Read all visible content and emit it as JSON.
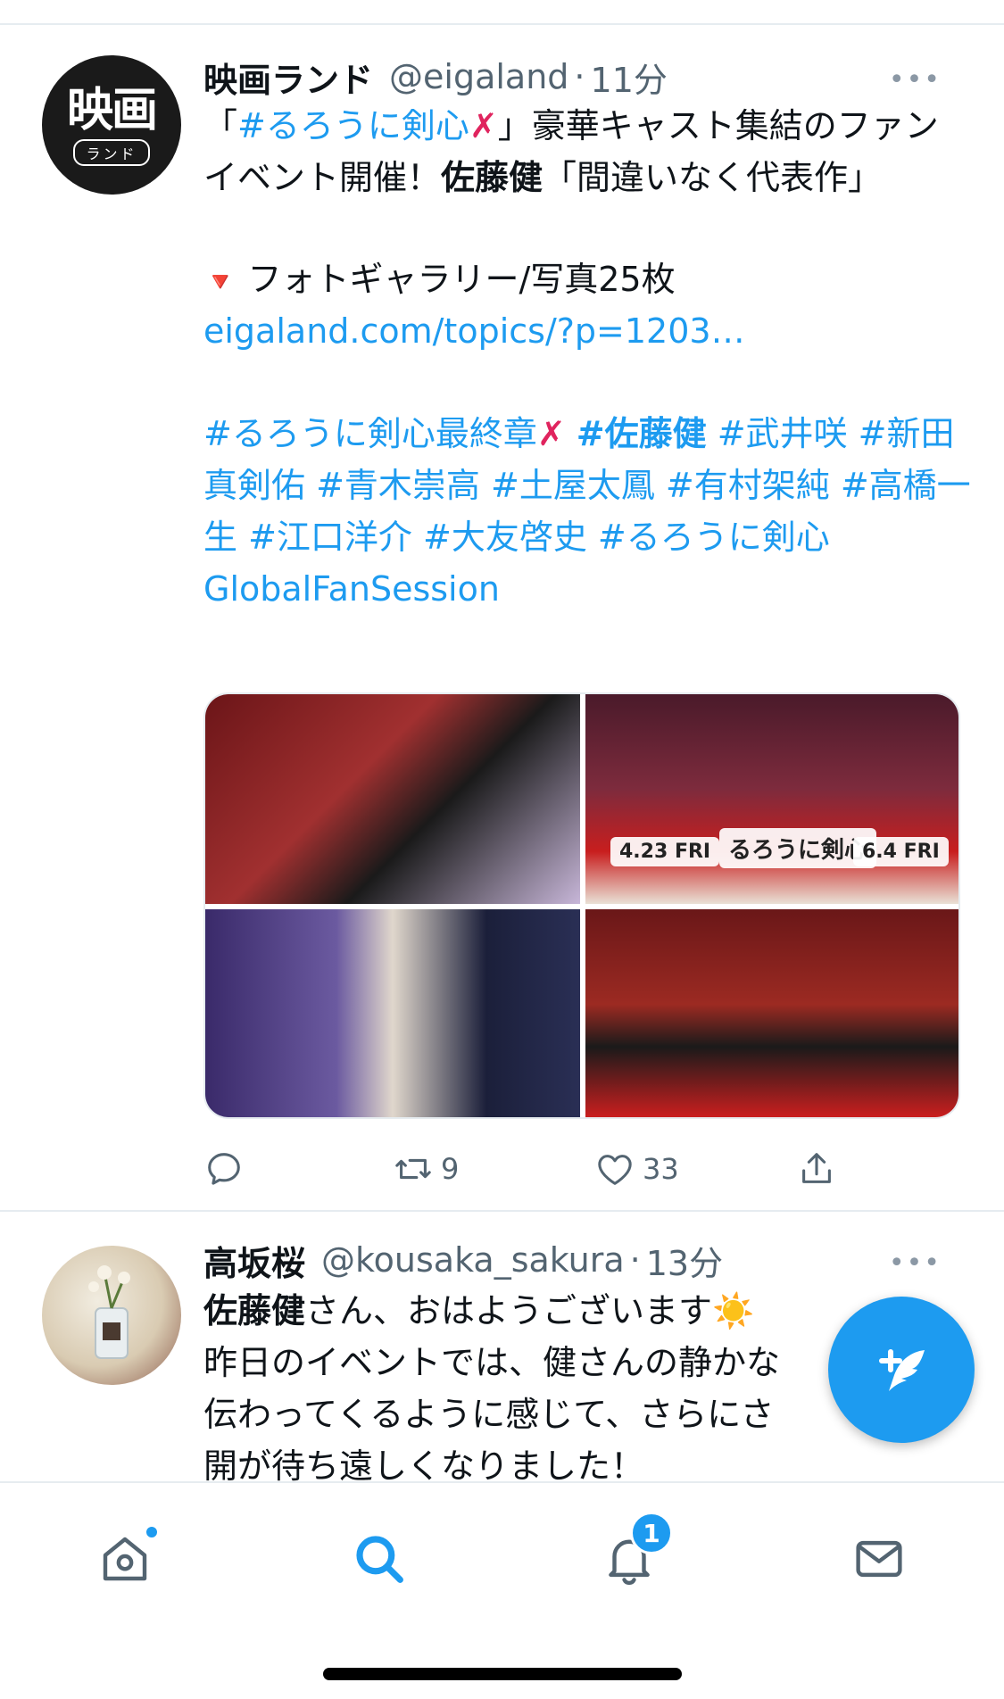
{
  "tweets": [
    {
      "avatar_main": "映画",
      "avatar_sub": "ランド",
      "name": "映画ランド",
      "handle": "@eigaland",
      "separator": "·",
      "time": "11分",
      "more": "•••",
      "body": {
        "open_quote": "「",
        "hashtag1": "#るろうに剣心",
        "x1": "✗",
        "text1": "」豪華キャスト集結のファンイベント開催！",
        "name_bold": "佐藤健",
        "text2": "「間違いなく代表作」",
        "tri": "🔻",
        "gallery": " フォトギャラリー/写真25枚",
        "link": "eigaland.com/topics/?p=1203…",
        "tag1": "#るろうに剣心最終章",
        "x2": "✗",
        "tag2": "#佐藤健",
        "tags": "#武井咲 #新田真剣佑 #青木崇高 #土屋太鳳 #有村架純 #高橋一生 #江口洋介 #大友啓史 #るろうに剣心GlobalFanSession"
      },
      "media": {
        "card_left": "4.23 FRI",
        "card_title": "るろうに剣心",
        "card_right": "6.4 FRI"
      },
      "actions": {
        "reply_count": "",
        "retweet_count": "9",
        "like_count": "33"
      }
    },
    {
      "name": "高坂桜",
      "handle": "@kousaka_sakura",
      "separator": "·",
      "time": "13分",
      "more": "•••",
      "body": {
        "name_bold": "佐藤健",
        "line1": "さん、おはようございます☀️",
        "line2": "昨日のイベントでは、健さんの静かな",
        "line3": "伝わってくるように感じて、さらにさ",
        "line4": "開が待ち遠しくなりました！"
      }
    }
  ],
  "tabbar": {
    "notifications_badge": "1"
  },
  "colors": {
    "accent": "#1d9bf0",
    "text": "#0f1419",
    "muted": "#536471",
    "divider": "#e6ecf0"
  }
}
